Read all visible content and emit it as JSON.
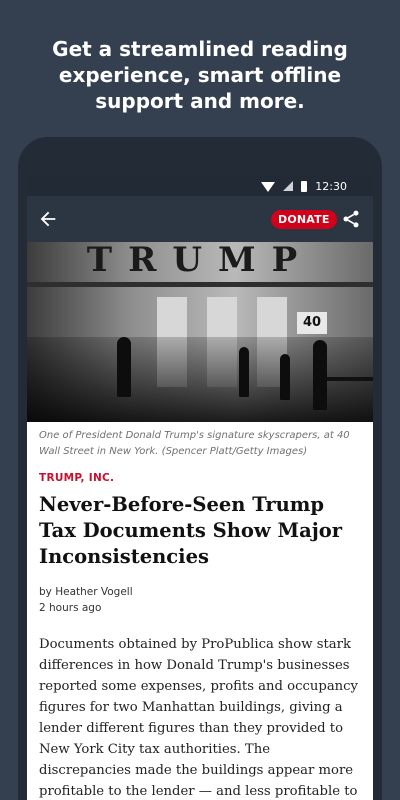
{
  "promo": {
    "line1": "Get a streamlined reading",
    "line2": "experience, smart offline",
    "line3": "support and more."
  },
  "statusbar": {
    "time": "12:30",
    "icons": [
      "wifi-icon",
      "signal-icon",
      "battery-icon"
    ]
  },
  "toolbar": {
    "back_icon": "arrow-left-icon",
    "donate_label": "DONATE",
    "donate_color": "#d0021b",
    "share_icon": "share-icon"
  },
  "photo": {
    "sign_text": "TRUMP",
    "number_plate": "40"
  },
  "article": {
    "caption": "One of President Donald Trump's signature skyscrapers, at 40 Wall Street in New York. (Spencer Platt/Getty Images)",
    "kicker": "TRUMP, INC.",
    "headline": "Never-Before-Seen Trump Tax Documents Show Major Inconsistencies",
    "author": "by Heather Vogell",
    "time": "2 hours ago",
    "body": "Documents obtained by ProPublica show stark differences in how Donald Trump's businesses reported some expenses, profits and occupancy figures for two Manhattan buildings, giving a lender different figures than they provided to New York City tax authorities. The discrepancies made the buildings appear more profitable to the lender — and less profitable to the officials who set the buildings' property tax."
  },
  "colors": {
    "background": "#34404f",
    "toolbar": "#2c3542",
    "kicker": "#c8102e"
  }
}
